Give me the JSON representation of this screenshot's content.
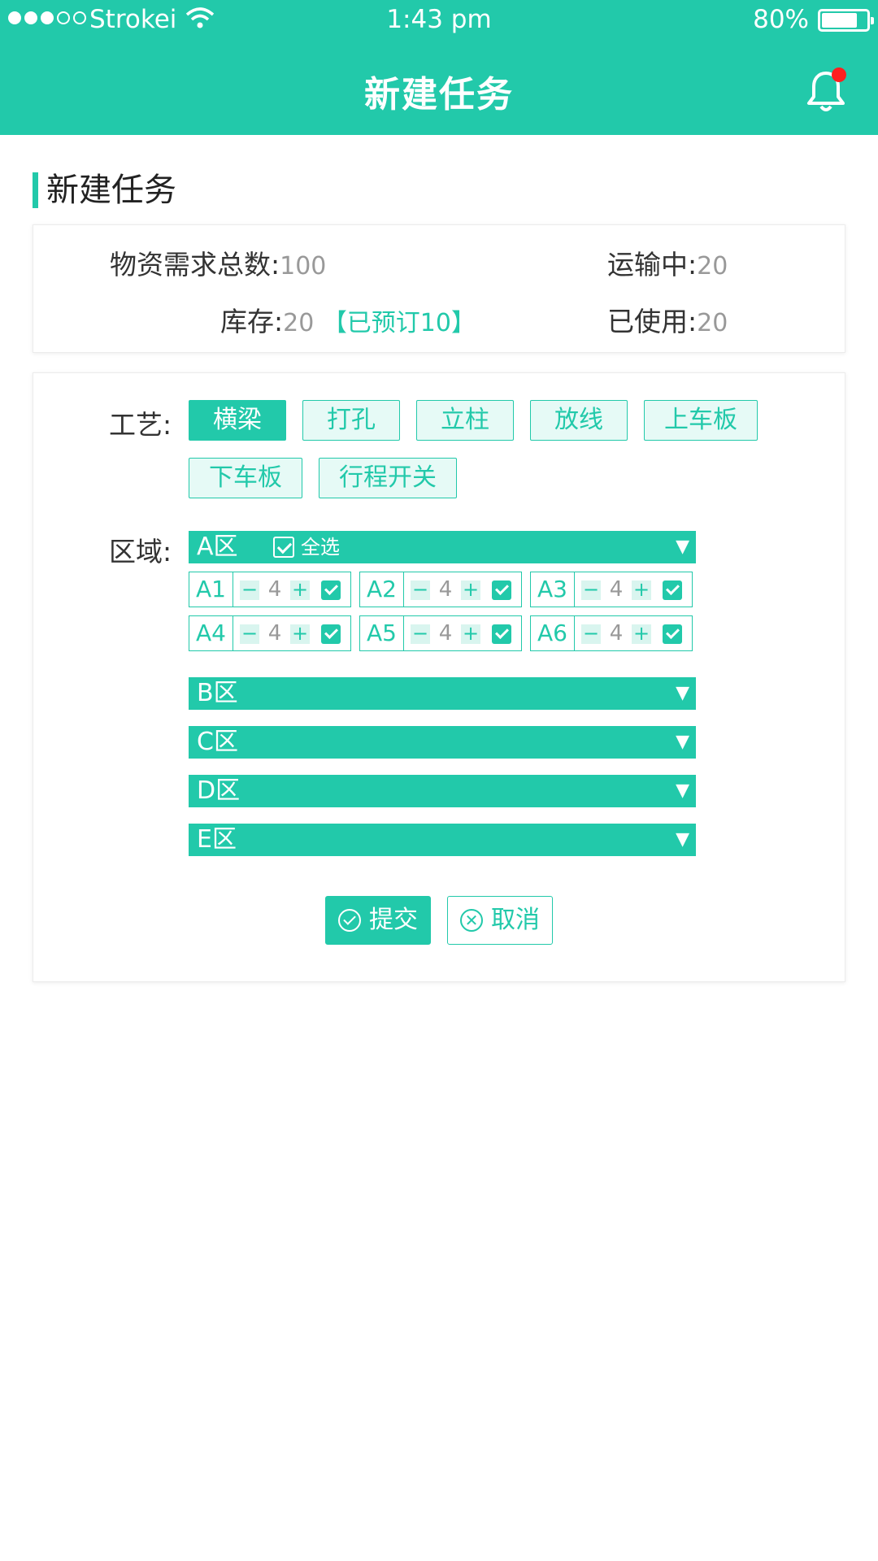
{
  "status_bar": {
    "carrier": "Strokei",
    "time": "1:43 pm",
    "battery": "80%",
    "battery_level": 0.8
  },
  "nav": {
    "title": "新建任务",
    "icon": "bell-icon",
    "has_notification": true
  },
  "section": {
    "title": "新建任务"
  },
  "summary": {
    "total_label": "物资需求总数:",
    "total_value": "100",
    "transit_label": "运输中:",
    "transit_value": "20",
    "stock_label": "库存:",
    "stock_value": "20",
    "reserved": "【已预订10】",
    "used_label": "已使用:",
    "used_value": "20"
  },
  "process": {
    "label": "工艺:",
    "options": [
      "横梁",
      "打孔",
      "立柱",
      "放线",
      "上车板",
      "下车板",
      "行程开关"
    ],
    "selected": "横梁"
  },
  "zones": {
    "label": "区域:",
    "select_all": "全选",
    "items": [
      {
        "name": "A区",
        "expanded": true,
        "subs": [
          {
            "name": "A1",
            "qty": "4",
            "minus": "−",
            "plus": "+",
            "checked": true
          },
          {
            "name": "A2",
            "qty": "4",
            "minus": "−",
            "plus": "+",
            "checked": true
          },
          {
            "name": "A3",
            "qty": "4",
            "minus": "−",
            "plus": "+",
            "checked": true
          },
          {
            "name": "A4",
            "qty": "4",
            "minus": "−",
            "plus": "+",
            "checked": true
          },
          {
            "name": "A5",
            "qty": "4",
            "minus": "−",
            "plus": "+",
            "checked": true
          },
          {
            "name": "A6",
            "qty": "4",
            "minus": "−",
            "plus": "+",
            "checked": true
          }
        ]
      },
      {
        "name": "B区",
        "expanded": false
      },
      {
        "name": "C区",
        "expanded": false
      },
      {
        "name": "D区",
        "expanded": false
      },
      {
        "name": "E区",
        "expanded": false
      }
    ]
  },
  "buttons": {
    "submit": "提交",
    "cancel": "取消"
  },
  "colors": {
    "accent": "#22c9aa",
    "accent_light": "#e6faf6",
    "notification": "#ff1f1f"
  }
}
